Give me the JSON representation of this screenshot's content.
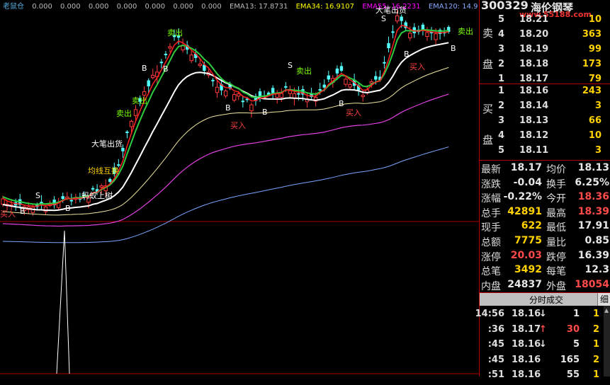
{
  "indicators": {
    "name": "老鼠仓",
    "values": [
      "0.000",
      "0.000",
      "0.000",
      "0.000",
      "0.000",
      "0.000",
      "0.000"
    ],
    "ema1": "EMA13: 17.8731",
    "ema2": "EMA34: 16.9107",
    "ema3": "EMA55: 16.2231",
    "ema4": "EMA120: 14.9"
  },
  "chart_labels": {
    "sell1": "卖出",
    "sell2": "卖出",
    "sell3": "卖出",
    "sell4": "卖出",
    "sell5": "卖出",
    "buy1": "买入",
    "buy2": "买入",
    "buy3": "买入",
    "buy4": "买入",
    "stroke_sell": "大笔出货",
    "stroke_sell2": "大笔出货",
    "switch": "均线互换",
    "climb": "蚂蚁上树",
    "b_mark": "B",
    "s_mark": "S"
  },
  "stock": {
    "code": "300329",
    "name": "海伦钢琴",
    "watermark": "www.55188.com"
  },
  "order_book": {
    "sell_label": "卖盘",
    "buy_label": "买盘",
    "asks": [
      {
        "lvl": "5",
        "price": "18.21",
        "vol": "10"
      },
      {
        "lvl": "4",
        "price": "18.20",
        "vol": "363"
      },
      {
        "lvl": "3",
        "price": "18.19",
        "vol": "99"
      },
      {
        "lvl": "2",
        "price": "18.18",
        "vol": "173"
      },
      {
        "lvl": "1",
        "price": "18.17",
        "vol": "79"
      }
    ],
    "bids": [
      {
        "lvl": "1",
        "price": "18.16",
        "vol": "243"
      },
      {
        "lvl": "2",
        "price": "18.14",
        "vol": "3"
      },
      {
        "lvl": "3",
        "price": "18.13",
        "vol": "66"
      },
      {
        "lvl": "4",
        "price": "18.12",
        "vol": "10"
      },
      {
        "lvl": "5",
        "price": "18.11",
        "vol": "3"
      }
    ]
  },
  "stats": [
    {
      "k1": "最新",
      "v1": "18.17",
      "c1": "#e6e6e6",
      "k2": "均价",
      "v2": "18.13",
      "c2": "#e6e6e6"
    },
    {
      "k1": "涨跌",
      "v1": "-0.04",
      "c1": "#e6e6e6",
      "k2": "换手",
      "v2": "6.25%",
      "c2": "#e6e6e6"
    },
    {
      "k1": "涨幅",
      "v1": "-0.22%",
      "c1": "#e6e6e6",
      "k2": "今开",
      "v2": "18.36",
      "c2": "#ff4a4a"
    },
    {
      "k1": "总手",
      "v1": "42891",
      "c1": "#ffd200",
      "k2": "最高",
      "v2": "18.39",
      "c2": "#ff4a4a"
    },
    {
      "k1": "现手",
      "v1": "622",
      "c1": "#ffd200",
      "k2": "最低",
      "v2": "17.91",
      "c2": "#e6e6e6"
    },
    {
      "k1": "总额",
      "v1": "7775",
      "c1": "#ffd200",
      "k2": "量比",
      "v2": "0.85",
      "c2": "#e6e6e6"
    },
    {
      "k1": "涨停",
      "v1": "20.03",
      "c1": "#ff4a4a",
      "k2": "跌停",
      "v2": "16.39",
      "c2": "#e6e6e6"
    },
    {
      "k1": "总笔",
      "v1": "3492",
      "c1": "#ffd200",
      "k2": "每笔",
      "v2": "12.3",
      "c2": "#e6e6e6"
    },
    {
      "k1": "内盘",
      "v1": "24837",
      "c1": "#e6e6e6",
      "k2": "外盘",
      "v2": "18054",
      "c2": "#ff4a4a"
    }
  ],
  "ticks_panel": {
    "title": "分时成交",
    "detail_btn": "细"
  },
  "ticks": [
    {
      "time": "14:56",
      "price": "18.16",
      "dir": "↓",
      "dir_color": "#e6e6e6",
      "vol": "1",
      "vol_color": "#e6e6e6",
      "n": "1"
    },
    {
      "time": ":36",
      "price": "18.17",
      "dir": "↑",
      "dir_color": "#ff4a4a",
      "vol": "30",
      "vol_color": "#ff4a4a",
      "n": "2"
    },
    {
      "time": ":45",
      "price": "18.16",
      "dir": "↓",
      "dir_color": "#e6e6e6",
      "vol": "5",
      "vol_color": "#e6e6e6",
      "n": "1"
    },
    {
      "time": ":45",
      "price": "18.16",
      "dir": "",
      "dir_color": "#e6e6e6",
      "vol": "165",
      "vol_color": "#e6e6e6",
      "n": "2"
    },
    {
      "time": ":51",
      "price": "18.16",
      "dir": "",
      "dir_color": "#e6e6e6",
      "vol": "55",
      "vol_color": "#e6e6e6",
      "n": "1"
    }
  ]
}
